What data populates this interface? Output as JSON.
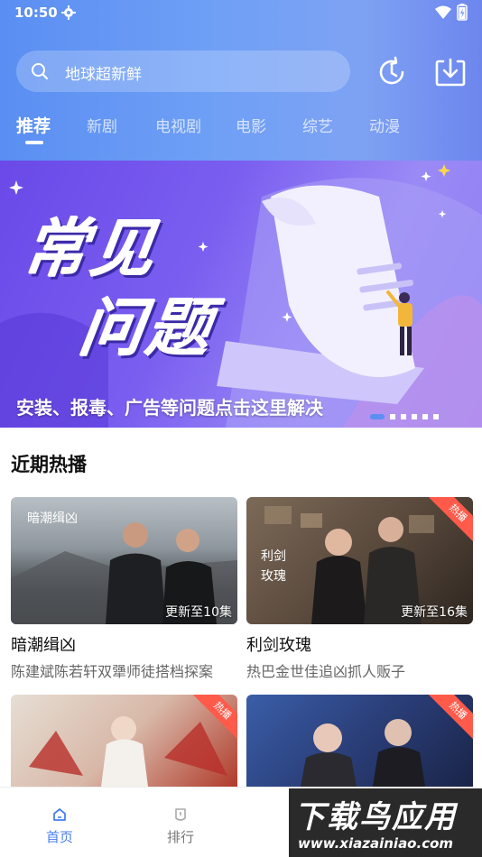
{
  "status_bar": {
    "time": "10:50"
  },
  "search": {
    "placeholder": "地球超新鲜"
  },
  "tabs": [
    {
      "label": "推荐",
      "active": true
    },
    {
      "label": "新剧",
      "active": false
    },
    {
      "label": "电视剧",
      "active": false
    },
    {
      "label": "电影",
      "active": false
    },
    {
      "label": "综艺",
      "active": false
    },
    {
      "label": "动漫",
      "active": false
    }
  ],
  "banner": {
    "title_line1": "常见",
    "title_line2": "问题",
    "caption": "安装、报毒、广告等问题点击这里解决",
    "dot_count": 6,
    "active_dot": 0
  },
  "section": {
    "title": "近期热播"
  },
  "cards": [
    {
      "title": "暗潮缉凶",
      "desc": "陈建斌陈若轩双犟师徒搭档探案",
      "update": "更新至10集",
      "hot": false
    },
    {
      "title": "利剑玫瑰",
      "desc": "热巴金世佳追凶抓人贩子",
      "update": "更新至16集",
      "hot": true
    },
    {
      "title": "",
      "desc": "",
      "update": "",
      "hot": true
    },
    {
      "title": "",
      "desc": "",
      "update": "",
      "hot": true
    }
  ],
  "hot_tag_label": "热播",
  "bottom_nav": [
    {
      "label": "首页",
      "active": true
    },
    {
      "label": "排行",
      "active": false
    }
  ],
  "watermark": {
    "big": "下载鸟应用",
    "small": "www.xiazainiao.com"
  },
  "colors": {
    "accent": "#5d8ff2",
    "nav_active": "#4a7ff0",
    "nav_inactive": "#777777"
  }
}
